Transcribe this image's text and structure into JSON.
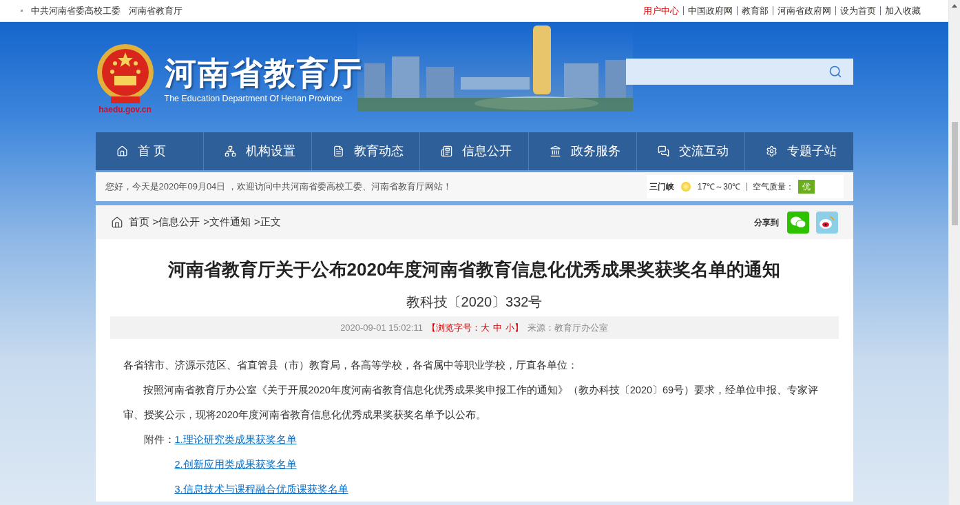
{
  "top_bar": {
    "left_links": [
      "中共河南省委高校工委",
      "河南省教育厅"
    ],
    "right_links": [
      {
        "label": "用户中心",
        "highlight": true
      },
      {
        "label": "中国政府网",
        "highlight": false
      },
      {
        "label": "教育部",
        "highlight": false
      },
      {
        "label": "河南省政府网",
        "highlight": false
      },
      {
        "label": "设为首页",
        "highlight": false
      },
      {
        "label": "加入收藏",
        "highlight": false
      }
    ]
  },
  "header": {
    "site_name": "河南省教育厅",
    "site_subtitle": "The Education Department Of Henan Province",
    "domain": "haedu.gov.cn"
  },
  "nav": [
    "首 页",
    "机构设置",
    "教育动态",
    "信息公开",
    "政务服务",
    "交流互动",
    "专题子站"
  ],
  "greeting": "您好，今天是2020年09月04日 ，欢迎访问中共河南省委高校工委、河南省教育厅网站！",
  "weather": {
    "city": "三门峡",
    "temperature": "17℃～30℃",
    "air_label": "空气质量：",
    "air_quality": "优"
  },
  "breadcrumb": [
    "首页",
    ">信息公开",
    ">文件通知",
    ">正文"
  ],
  "share_label": "分享到",
  "article": {
    "title": "河南省教育厅关于公布2020年度河南省教育信息化优秀成果奖获奖名单的通知",
    "doc_number": "教科技〔2020〕332号",
    "datetime": "2020-09-01 15:02:11",
    "font_size": {
      "prefix": "【浏览字号：",
      "options": [
        "大",
        "中",
        "小"
      ],
      "suffix": "】"
    },
    "source": "来源：教育厅办公室",
    "paragraphs": [
      {
        "text": "各省辖市、济源示范区、省直管县（市）教育局，各高等学校，各省属中等职业学校，厅直各单位：",
        "indent": false
      },
      {
        "text": "按照河南省教育厅办公室《关于开展2020年度河南省教育信息化优秀成果奖申报工作的通知》（教办科技〔2020〕69号）要求，经单位申报、专家评审、授奖公示，现将2020年度河南省教育信息化优秀成果奖获奖名单予以公布。",
        "indent": true
      }
    ],
    "attachment_label": "附件：",
    "attachments": [
      "1.理论研究类成果获奖名单",
      "2.创新应用类成果获奖名单",
      "3.信息技术与课程融合优质课获奖名单"
    ]
  }
}
